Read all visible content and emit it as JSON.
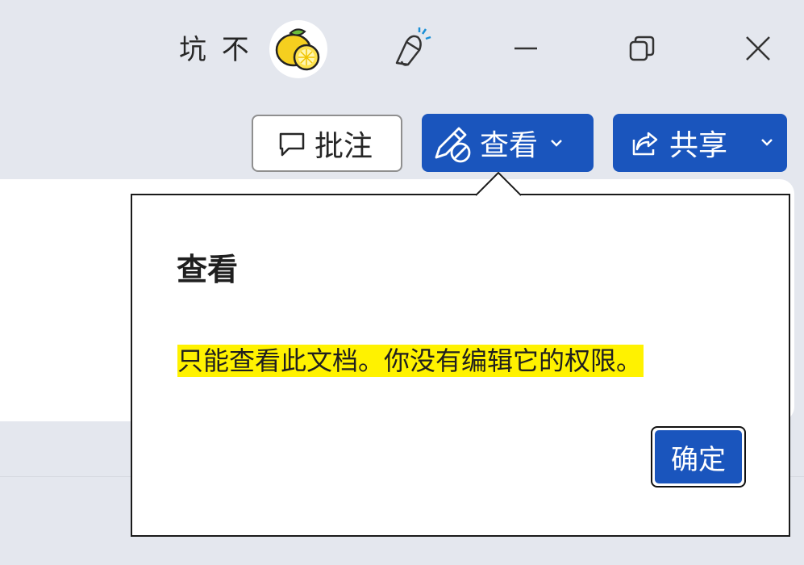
{
  "titlebar": {
    "user_name": "坑 不",
    "avatar_icon": "lemon-avatar",
    "icons": [
      "lightbulb-icon",
      "minimize-icon",
      "restore-icon",
      "close-icon"
    ]
  },
  "ribbon": {
    "comment_label": "批注",
    "view_label": "查看",
    "share_label": "共享"
  },
  "callout": {
    "title": "查看",
    "message": "只能查看此文档。你没有编辑它的权限。",
    "ok_label": "确定",
    "highlight_color": "#fff200"
  },
  "colors": {
    "accent": "#1a55bd",
    "background": "#e4e7ee"
  }
}
